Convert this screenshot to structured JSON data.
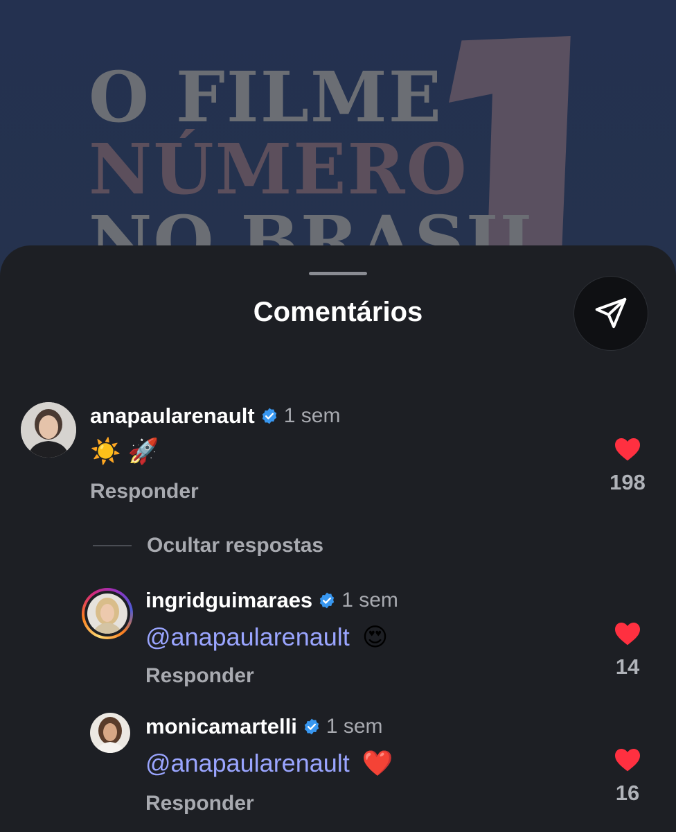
{
  "background_poster": {
    "line1": "O FILME",
    "line2": "NÚMERO",
    "line3": "NO BRASIL",
    "colors": {
      "text": "#6b6e74",
      "accent": "#5a5060",
      "bg": "#243150"
    }
  },
  "sheet": {
    "title": "Comentários",
    "share_icon": "send-icon"
  },
  "comments": [
    {
      "username": "anapaularenault",
      "verified": true,
      "time": "1 sem",
      "text": "☀️ 🚀",
      "reply_label": "Responder",
      "likes": "198"
    }
  ],
  "replies_toggle": "Ocultar respostas",
  "replies": [
    {
      "username": "ingridguimaraes",
      "verified": true,
      "time": "1 sem",
      "mention": "@anapaularenault",
      "emoji": "😍",
      "reply_label": "Responder",
      "likes": "14",
      "has_story_ring": true
    },
    {
      "username": "monicamartelli",
      "verified": true,
      "time": "1 sem",
      "mention": "@anapaularenault",
      "emoji": "❤️",
      "reply_label": "Responder",
      "likes": "16",
      "has_story_ring": false
    }
  ],
  "colors": {
    "sheet_bg": "#1d1f24",
    "mention": "#9aa5ff",
    "verified_blue": "#3897f0",
    "heart": "#ff3040"
  }
}
